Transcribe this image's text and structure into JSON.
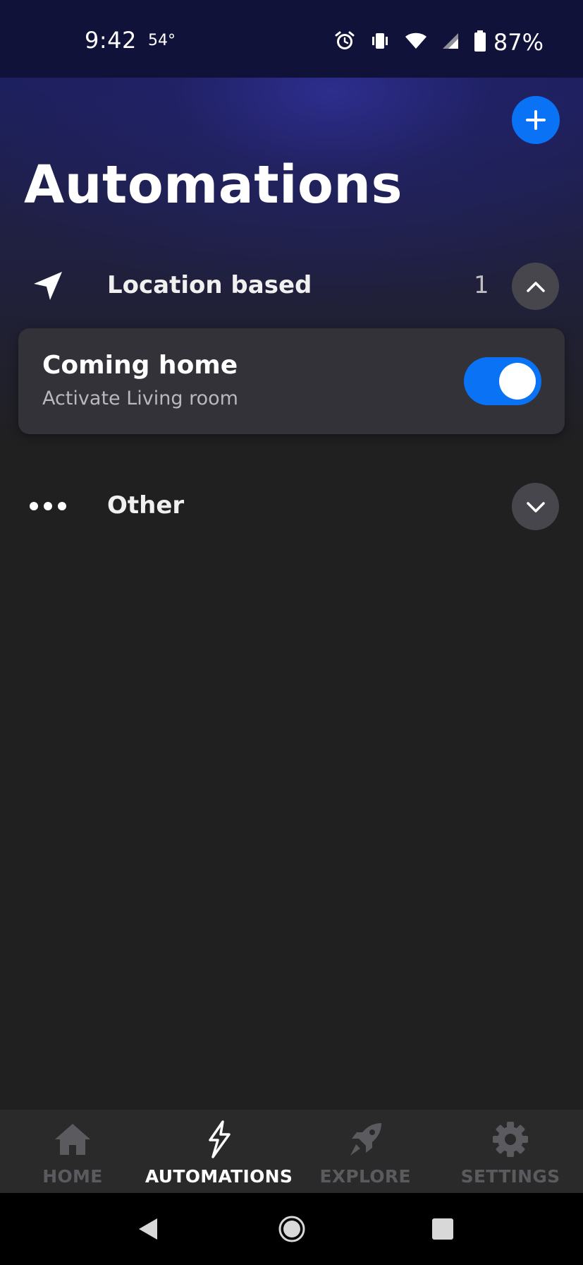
{
  "status_bar": {
    "time": "9:42",
    "temperature": "54°",
    "battery": "87%",
    "icons": [
      "alarm-icon",
      "vibrate-icon",
      "wifi-icon",
      "signal-icon",
      "battery-icon"
    ]
  },
  "header": {
    "title": "Automations",
    "add_icon": "plus-icon"
  },
  "sections": [
    {
      "label": "Location based",
      "count": "1",
      "icon": "location-arrow-icon",
      "expanded": true
    },
    {
      "label": "Other",
      "icon": "more-dots-icon",
      "expanded": false
    }
  ],
  "automations": [
    {
      "title": "Coming home",
      "subtitle": "Activate Living room",
      "enabled": true
    }
  ],
  "bottom_nav": {
    "items": [
      {
        "label": "HOME",
        "icon": "home-icon",
        "active": false
      },
      {
        "label": "AUTOMATIONS",
        "icon": "lightning-icon",
        "active": true
      },
      {
        "label": "EXPLORE",
        "icon": "rocket-icon",
        "active": false
      },
      {
        "label": "SETTINGS",
        "icon": "gear-icon",
        "active": false
      }
    ]
  },
  "system_nav": {
    "icons": [
      "back-icon",
      "home-circle-icon",
      "recents-icon"
    ]
  },
  "colors": {
    "accent": "#0a72f5",
    "background": "#202020",
    "card": "#323238",
    "inactive_nav": "#5b5b5f"
  }
}
